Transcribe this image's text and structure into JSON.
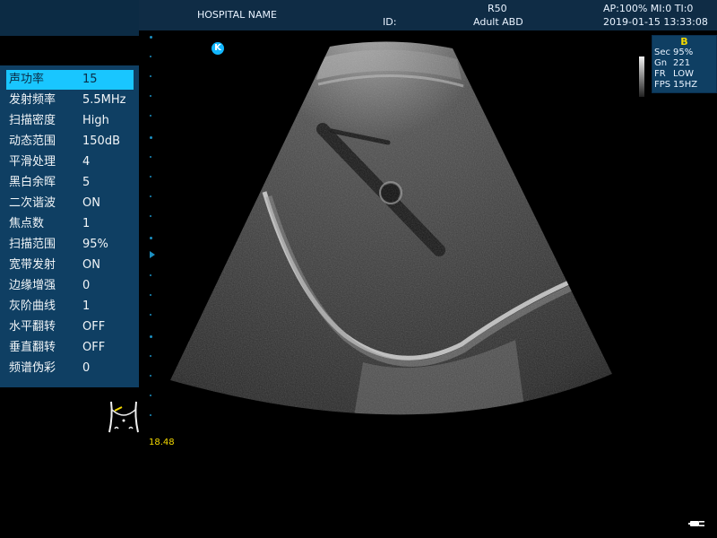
{
  "header": {
    "hospital_name": "HOSPITAL NAME",
    "id_label": "ID:",
    "probe": "R50",
    "preset": "Adult ABD",
    "acoustic_status": "AP:100% MI:0 TI:0",
    "datetime": "2019-01-15 13:33:08"
  },
  "parameters": [
    {
      "label": "声功率",
      "value": "15"
    },
    {
      "label": "发射频率",
      "value": "5.5MHz"
    },
    {
      "label": "扫描密度",
      "value": "High"
    },
    {
      "label": "动态范围",
      "value": "150dB"
    },
    {
      "label": "平滑处理",
      "value": "4"
    },
    {
      "label": "黑白余晖",
      "value": "5"
    },
    {
      "label": "二次谐波",
      "value": "ON"
    },
    {
      "label": "焦点数",
      "value": "1"
    },
    {
      "label": "扫描范围",
      "value": "95%"
    },
    {
      "label": "宽带发射",
      "value": "ON"
    },
    {
      "label": "边缘增强",
      "value": "0"
    },
    {
      "label": "灰阶曲线",
      "value": "1"
    },
    {
      "label": "水平翻转",
      "value": "OFF"
    },
    {
      "label": "垂直翻转",
      "value": "OFF"
    },
    {
      "label": "频谱伪彩",
      "value": "0"
    }
  ],
  "selected_parameter_index": 0,
  "image_info": {
    "mode": "B",
    "lines": [
      {
        "key": "Sec",
        "value": "95%"
      },
      {
        "key": "Gn",
        "value": "221"
      },
      {
        "key": "FR",
        "value": "LOW"
      },
      {
        "key": "FPS",
        "value": "15HZ"
      }
    ]
  },
  "k_marker": "K",
  "depth_readout": "18.48",
  "colors": {
    "topbar": "#0f2c45",
    "panel": "#0f3f63",
    "selection": "#19c6ff",
    "accent_yellow": "#f4d900",
    "tick_blue": "#1c8fc0"
  },
  "icons": {
    "body_mark": "abdomen-body-mark-icon",
    "k_marker": "k-marker-icon",
    "power": "power-plug-icon"
  }
}
